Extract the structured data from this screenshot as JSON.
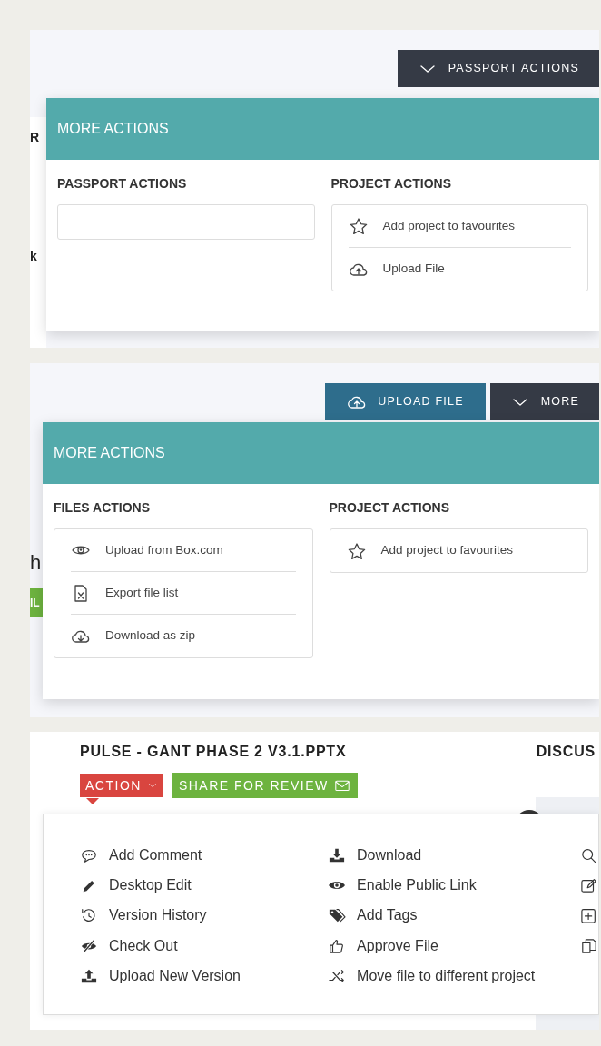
{
  "panels": [
    {
      "kind": "passport",
      "fragments": [
        "R",
        "k"
      ],
      "buttons": [
        {
          "kind": "more",
          "label": "PASSPORT ACTIONS"
        }
      ],
      "menu": {
        "title": "MORE ACTIONS",
        "sections": [
          {
            "heading": "PASSPORT ACTIONS"
          },
          {
            "heading": "PROJECT ACTIONS",
            "items": [
              "Add project to favourites",
              "Upload File"
            ]
          }
        ]
      }
    },
    {
      "kind": "files",
      "fragments": [
        "h",
        "IL"
      ],
      "buttons": [
        {
          "kind": "upload",
          "label": "UPLOAD FILE"
        },
        {
          "kind": "more",
          "label": "MORE"
        }
      ],
      "menu": {
        "title": "MORE ACTIONS",
        "sections": [
          {
            "heading": "FILES ACTIONS",
            "items": [
              "Upload from Box.com",
              "Export file list",
              "Download as zip"
            ]
          },
          {
            "heading": "PROJECT ACTIONS",
            "items": [
              "Add project to favourites"
            ]
          }
        ]
      }
    },
    {
      "kind": "file",
      "file_title": "PULSE - GANT PHASE 2 V3.1.PPTX",
      "side_heading": "DISCUS",
      "action_button": "ACTION",
      "share_button": "SHARE FOR REVIEW",
      "columns": [
        [
          "Add Comment",
          "Desktop Edit",
          "Version History",
          "Check Out",
          "Upload New Version"
        ],
        [
          "Download",
          "Enable Public Link",
          "Add Tags",
          "Approve File",
          "Move file to different project"
        ]
      ]
    }
  ]
}
